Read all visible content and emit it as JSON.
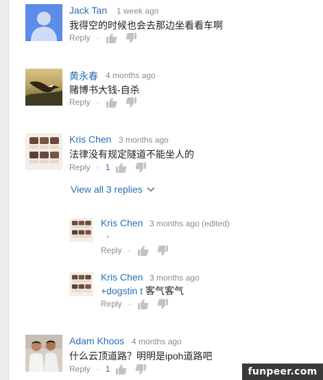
{
  "comments": [
    {
      "author": "Jack Tan",
      "time": "1 week ago",
      "text": "我得空的时候也会去那边坐看看车啊",
      "reply": "Reply",
      "dot": "·",
      "likes": ""
    },
    {
      "author": "黄永春",
      "time": "4 months ago",
      "text": "赌博书大钱-自杀",
      "reply": "Reply",
      "dot": "·",
      "likes": ""
    },
    {
      "author": "Kris Chen",
      "time": "3 months ago",
      "text": "法律没有规定隧道不能坐人的",
      "reply": "Reply",
      "dot": "·",
      "likes": "1"
    }
  ],
  "view_replies": "View all 3 replies",
  "replies": [
    {
      "author": "Kris Chen",
      "time": "3 months ago (edited)",
      "text": ".",
      "reply": "Reply",
      "dot": "·"
    },
    {
      "author": "Kris Chen",
      "time": "3 months ago",
      "mention": "+dogstin t",
      "text": " 客气客气",
      "reply": "Reply",
      "dot": "·"
    }
  ],
  "last_comment": {
    "author": "Adam Khoos",
    "time": "4 months ago",
    "text": "什么云顶道路？明明是ipoh道路吧",
    "reply": "Reply",
    "dot": "·",
    "likes": "1"
  },
  "watermark": "funpeer.com",
  "colors": {
    "link": "#2a6db5",
    "muted": "#8a8a8a",
    "text": "#222222",
    "thumb": "#c2c2c2"
  },
  "icons": {
    "like": "thumbs-up-icon",
    "dislike": "thumbs-down-icon",
    "expand": "chevron-down-icon"
  }
}
